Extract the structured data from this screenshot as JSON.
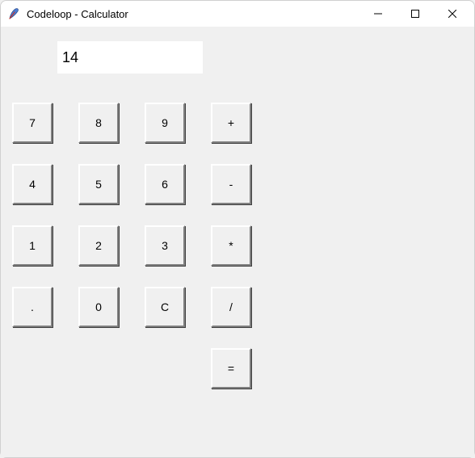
{
  "window": {
    "title": "Codeloop - Calculator"
  },
  "display": {
    "value": "14"
  },
  "buttons": {
    "r0c0": "7",
    "r0c1": "8",
    "r0c2": "9",
    "r0c3": "+",
    "r1c0": "4",
    "r1c1": "5",
    "r1c2": "6",
    "r1c3": "-",
    "r2c0": "1",
    "r2c1": "2",
    "r2c2": "3",
    "r2c3": "*",
    "r3c0": ".",
    "r3c1": "0",
    "r3c2": "C",
    "r3c3": "/",
    "eq": "="
  }
}
